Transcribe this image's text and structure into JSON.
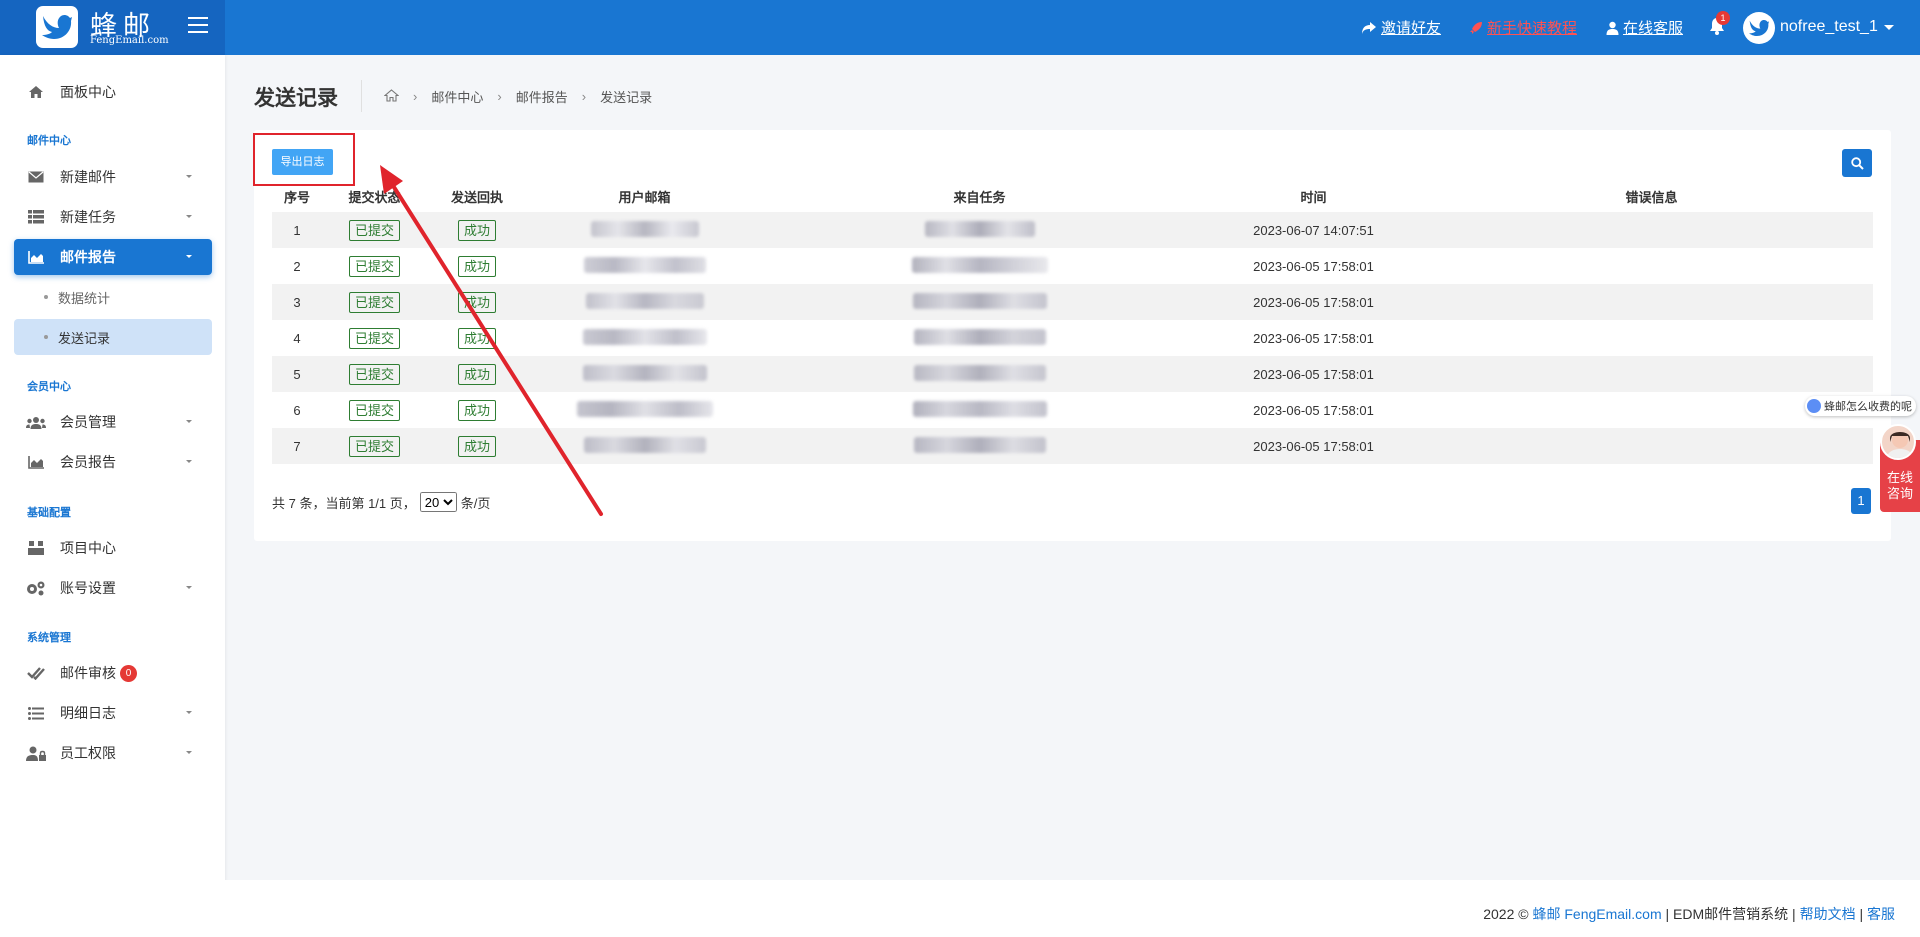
{
  "brand": {
    "name": "蜂邮",
    "sub": "FengEmail.com"
  },
  "topnav": {
    "invite": "邀请好友",
    "tutorial": "新手快速教程",
    "support": "在线客服",
    "bell_count": "1",
    "username": "nofree_test_1",
    "tutorial_color": "#ff5252"
  },
  "sidebar": {
    "dashboard": "面板中心",
    "section_mail": "邮件中心",
    "new_mail": "新建邮件",
    "new_task": "新建任务",
    "mail_report": "邮件报告",
    "sub_stats": "数据统计",
    "sub_records": "发送记录",
    "section_member": "会员中心",
    "member_manage": "会员管理",
    "member_report": "会员报告",
    "section_base": "基础配置",
    "project_center": "项目中心",
    "account_settings": "账号设置",
    "section_system": "系统管理",
    "mail_review": "邮件审核",
    "mail_review_count": "0",
    "detail_log": "明细日志",
    "staff_permission": "员工权限"
  },
  "page": {
    "title": "发送记录",
    "breadcrumb": [
      "邮件中心",
      "邮件报告",
      "发送记录"
    ],
    "export_label": "导出日志"
  },
  "table": {
    "headers": [
      "序号",
      "提交状态",
      "发送回执",
      "用户邮箱",
      "来自任务",
      "时间",
      "错误信息"
    ],
    "rows": [
      {
        "no": "1",
        "submit": "已提交",
        "receipt": "成功",
        "time": "2023-06-07 14:07:51",
        "error": ""
      },
      {
        "no": "2",
        "submit": "已提交",
        "receipt": "成功",
        "time": "2023-06-05 17:58:01",
        "error": ""
      },
      {
        "no": "3",
        "submit": "已提交",
        "receipt": "成功",
        "time": "2023-06-05 17:58:01",
        "error": ""
      },
      {
        "no": "4",
        "submit": "已提交",
        "receipt": "成功",
        "time": "2023-06-05 17:58:01",
        "error": ""
      },
      {
        "no": "5",
        "submit": "已提交",
        "receipt": "成功",
        "time": "2023-06-05 17:58:01",
        "error": ""
      },
      {
        "no": "6",
        "submit": "已提交",
        "receipt": "成功",
        "time": "2023-06-05 17:58:01",
        "error": ""
      },
      {
        "no": "7",
        "submit": "已提交",
        "receipt": "成功",
        "time": "2023-06-05 17:58:01",
        "error": ""
      }
    ]
  },
  "pager": {
    "summary": "共 7 条，当前第 1/1 页，",
    "page_size": "20",
    "page_size_options": [
      "20"
    ],
    "unit": "条/页",
    "current_page": "1"
  },
  "widgets": {
    "faq": "蜂邮怎么收费的呢",
    "consult": [
      "在线",
      "咨询"
    ]
  },
  "footer": {
    "prefix": "2022 ©",
    "brand_link": "蜂邮 FengEmail.com",
    "system": "| EDM邮件营销系统 |",
    "help_link": "帮助文档",
    "sep": "|",
    "service_link": "客服"
  },
  "colors": {
    "primary": "#1976d2",
    "success": "#2e7d32",
    "danger": "#e53935",
    "annotation": "#e0242c"
  }
}
